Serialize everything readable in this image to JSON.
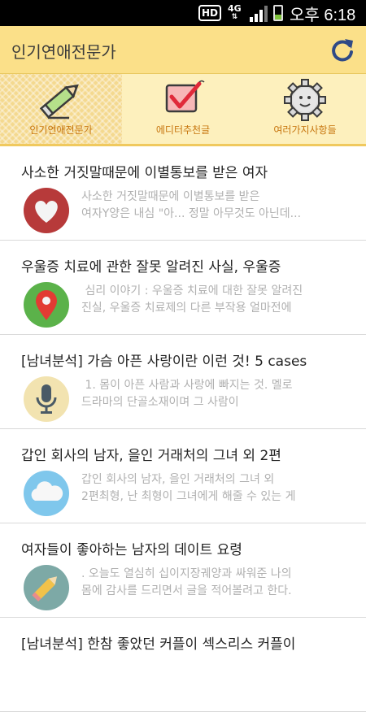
{
  "status_bar": {
    "hd": "HD",
    "network": "4G",
    "time": "오후 6:18"
  },
  "header": {
    "title": "인기연애전문가",
    "refresh_icon": "refresh-icon"
  },
  "tabs": [
    {
      "label": "인기연애전문가",
      "icon": "pencil-icon",
      "active": true
    },
    {
      "label": "에디터추천글",
      "icon": "checkmark-icon",
      "active": false
    },
    {
      "label": "여러가지사항들",
      "icon": "gear-face-icon",
      "active": false
    }
  ],
  "articles": [
    {
      "title": "사소한 거짓말때문에 이별통보를 받은 여자",
      "summary": "사소한 거짓말때문에 이별통보를 받은\n여자Y양은 내심 \"아... 정말 아무것도 아닌데...",
      "icon": "heart-icon"
    },
    {
      "title": "우울증 치료에 관한 잘못 알려진 사실, 우울증",
      "summary": " 심리 이야기 : 우울증 치료에 대한 잘못 알려진\n진실, 우울증 치료제의 다른 부작용 얼마전에",
      "icon": "map-pin-icon"
    },
    {
      "title": "[남녀분석] 가슴 아픈 사랑이란 이런 것! 5 cases",
      "summary": " 1. 몸이 아픈 사람과 사랑에 빠지는 것. 멜로\n드라마의 단골소재이며 그 사람이",
      "icon": "microphone-icon"
    },
    {
      "title": "갑인 회사의 남자, 을인 거래처의 그녀 외 2편",
      "summary": "갑인 회사의 남자, 을인 거래처의 그녀 외\n2편최형, 난 최형이 그녀에게 해줄 수 있는 게",
      "icon": "cloud-icon"
    },
    {
      "title": "여자들이 좋아하는 남자의 데이트 요령",
      "summary": ". 오늘도 열심히 십이지장궤양과 싸워준 나의\n몸에 감사를 드리면서 글을 적어볼려고 한다.",
      "icon": "pencil-circle-icon"
    },
    {
      "title": "[남녀분석] 한참 좋았던 커플이 섹스리스 커플이",
      "summary": "",
      "icon": ""
    }
  ],
  "colors": {
    "header_bg": "#fbe089",
    "tabbar_bg": "#fdf0bd",
    "tab_label": "#c7760f",
    "summary_text": "#b0b0b0"
  }
}
